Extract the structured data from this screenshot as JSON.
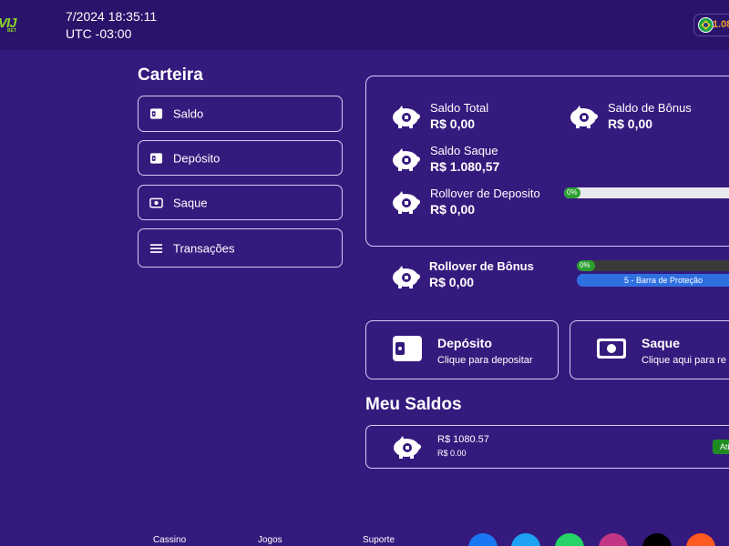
{
  "header": {
    "logo_text": "VIJ",
    "logo_sub": "BET",
    "datetime": "7/2024 18:35:11",
    "timezone": "UTC -03:00",
    "balance_short": "1.08"
  },
  "sidebar": {
    "title": "Carteira",
    "items": [
      {
        "label": "Saldo",
        "icon": "wallet-icon"
      },
      {
        "label": "Depósito",
        "icon": "wallet-icon"
      },
      {
        "label": "Saque",
        "icon": "cash-icon"
      },
      {
        "label": "Transações",
        "icon": "list-icon"
      }
    ]
  },
  "summary": {
    "saldo_total": {
      "title": "Saldo Total",
      "value": "R$ 0,00"
    },
    "saldo_bonus": {
      "title": "Saldo de Bônus",
      "value": "R$ 0,00"
    },
    "saldo_saque": {
      "title": "Saldo Saque",
      "value": "R$ 1.080,57"
    },
    "rollover_deposito": {
      "title": "Rollover de Deposito",
      "value": "R$ 0,00",
      "progress_label": "0%",
      "progress": 0
    }
  },
  "rollover_bonus": {
    "title": "Rollover de Bônus",
    "value": "R$ 0,00",
    "progress_label": "0%",
    "progress": 0,
    "protection_label": "5 - Barra de Proteção"
  },
  "actions": {
    "deposito": {
      "title": "Depósito",
      "subtitle": "Clique para depositar"
    },
    "saque": {
      "title": "Saque",
      "subtitle": "Clique aqui para re"
    }
  },
  "meus_saldos": {
    "title": "Meu Saldos",
    "rows": [
      {
        "amount": "R$ 1080.57",
        "secondary": "R$ 0.00",
        "status": "Ati"
      }
    ]
  },
  "footer": {
    "links": [
      "Cassino",
      "Jogos",
      "Suporte"
    ],
    "social": [
      {
        "name": "facebook-icon",
        "color": "#1877f2"
      },
      {
        "name": "twitter-icon",
        "color": "#1da1f2"
      },
      {
        "name": "whatsapp-icon",
        "color": "#25d366"
      },
      {
        "name": "instagram-icon",
        "color": "#c13584"
      },
      {
        "name": "tiktok-icon",
        "color": "#000000"
      },
      {
        "name": "kwai-icon",
        "color": "#ff5a1f"
      }
    ]
  },
  "colors": {
    "background": "#351a7e",
    "topbar": "#2a136b",
    "accent_green": "#2aa02f",
    "accent_blue": "#2f6fe0",
    "balance_orange": "#f1a12a"
  }
}
